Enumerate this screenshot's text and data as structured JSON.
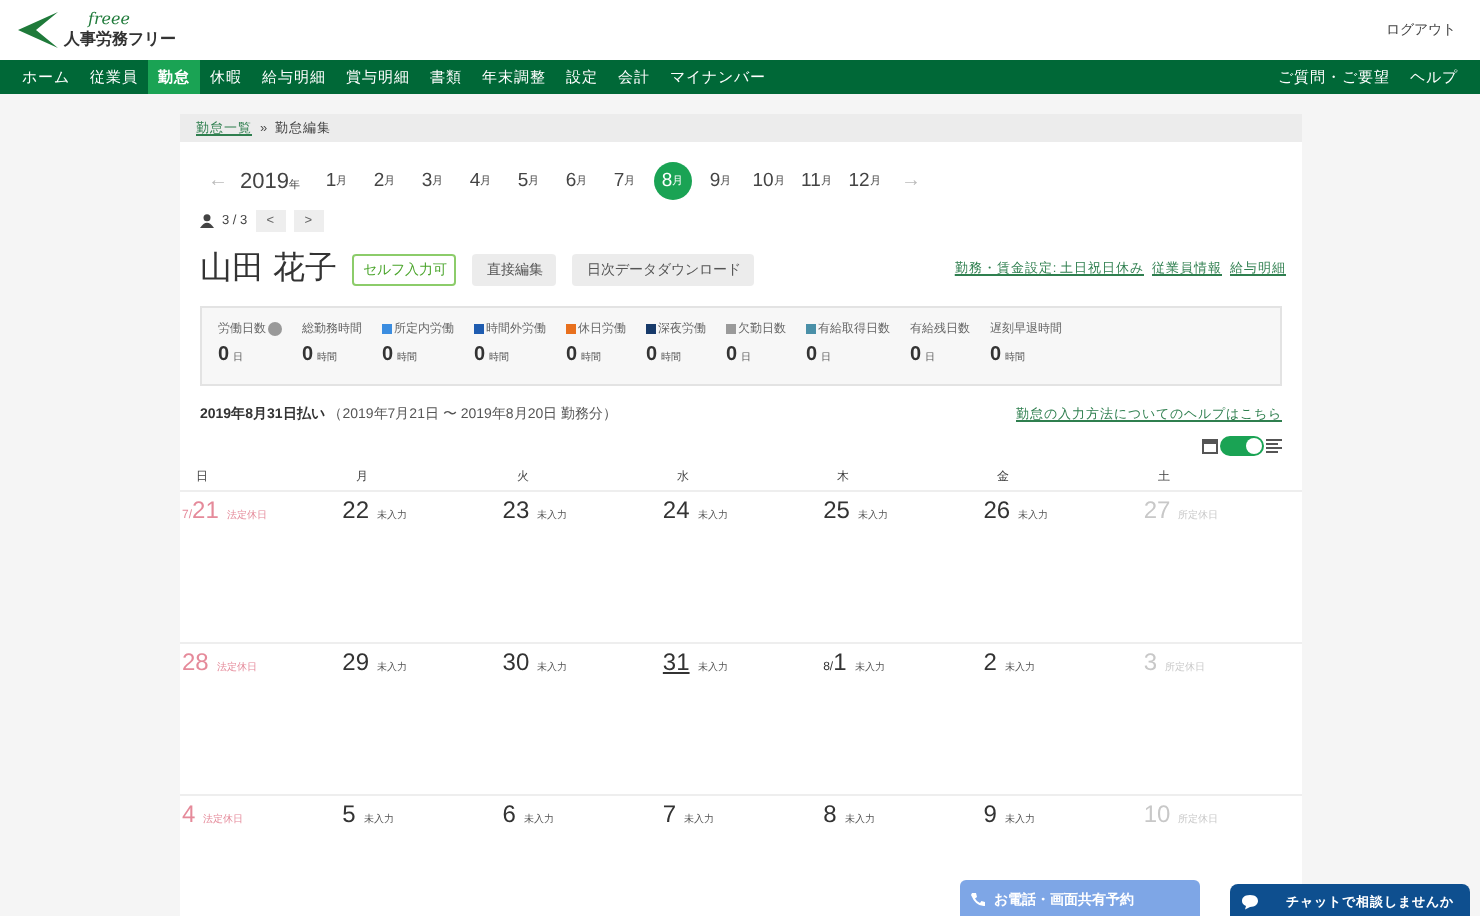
{
  "header": {
    "logo_script": "freee",
    "logo_text": "人事労務フリー",
    "logout": "ログアウト"
  },
  "nav": {
    "items": [
      {
        "label": "ホーム",
        "selected": false
      },
      {
        "label": "従業員",
        "selected": false
      },
      {
        "label": "勤怠",
        "selected": true
      },
      {
        "label": "休暇",
        "selected": false
      },
      {
        "label": "給与明細",
        "selected": false
      },
      {
        "label": "賞与明細",
        "selected": false
      },
      {
        "label": "書類",
        "selected": false
      },
      {
        "label": "年末調整",
        "selected": false
      },
      {
        "label": "設定",
        "selected": false
      },
      {
        "label": "会計",
        "selected": false
      },
      {
        "label": "マイナンバー",
        "selected": false
      }
    ],
    "right": [
      "ご質問・ご要望",
      "ヘルプ"
    ]
  },
  "breadcrumb": {
    "link": "勤怠一覧",
    "separator": "»",
    "current": "勤怠編集"
  },
  "months": {
    "prev": "←",
    "year": "2019",
    "year_unit": "年",
    "next": "→",
    "items": [
      {
        "label": "1",
        "unit": "月",
        "selected": false
      },
      {
        "label": "2",
        "unit": "月",
        "selected": false
      },
      {
        "label": "3",
        "unit": "月",
        "selected": false
      },
      {
        "label": "4",
        "unit": "月",
        "selected": false
      },
      {
        "label": "5",
        "unit": "月",
        "selected": false
      },
      {
        "label": "6",
        "unit": "月",
        "selected": false
      },
      {
        "label": "7",
        "unit": "月",
        "selected": false
      },
      {
        "label": "8",
        "unit": "月",
        "selected": true
      },
      {
        "label": "9",
        "unit": "月",
        "selected": false
      },
      {
        "label": "10",
        "unit": "月",
        "selected": false
      },
      {
        "label": "11",
        "unit": "月",
        "selected": false
      },
      {
        "label": "12",
        "unit": "月",
        "selected": false
      }
    ]
  },
  "pager": {
    "count": "3 / 3",
    "prev": "<",
    "next": ">"
  },
  "employee": {
    "name": "山田 花子",
    "badge": "セルフ入力可",
    "buttons": [
      "直接編集",
      "日次データダウンロード"
    ],
    "links": [
      "勤務・賃金設定: 土日祝日休み",
      "従業員情報",
      "給与明細"
    ]
  },
  "stats": [
    {
      "label": "労働日数",
      "help": true,
      "value": "0",
      "unit": "日"
    },
    {
      "label": "総勤務時間",
      "value": "0",
      "unit": "時間"
    },
    {
      "label": "所定内労働",
      "color": "#3b8de0",
      "value": "0",
      "unit": "時間"
    },
    {
      "label": "時間外労働",
      "color": "#1f5cb0",
      "value": "0",
      "unit": "時間"
    },
    {
      "label": "休日労働",
      "color": "#e8701e",
      "value": "0",
      "unit": "時間"
    },
    {
      "label": "深夜労働",
      "color": "#173a6a",
      "value": "0",
      "unit": "時間"
    },
    {
      "label": "欠勤日数",
      "color": "#9a9a9a",
      "value": "0",
      "unit": "日"
    },
    {
      "label": "有給取得日数",
      "color": "#4a90a8",
      "value": "0",
      "unit": "日"
    },
    {
      "label": "有給残日数",
      "value": "0",
      "unit": "日"
    },
    {
      "label": "遅刻早退時間",
      "value": "0",
      "unit": "時間"
    }
  ],
  "period": {
    "pay_date": "2019年8月31日払い",
    "range": "（2019年7月21日 〜 2019年8月20日 勤務分）",
    "help_link": "勤怠の入力方法についてのヘルプはこちら"
  },
  "view_toggle": {
    "on": true
  },
  "calendar": {
    "weekdays": [
      "日",
      "月",
      "火",
      "水",
      "木",
      "金",
      "土"
    ],
    "weeks": [
      [
        {
          "prefix": "7/",
          "day": "21",
          "status": "法定休日",
          "kind": "legal"
        },
        {
          "day": "22",
          "status": "未入力",
          "kind": "work"
        },
        {
          "day": "23",
          "status": "未入力",
          "kind": "work"
        },
        {
          "day": "24",
          "status": "未入力",
          "kind": "work"
        },
        {
          "day": "25",
          "status": "未入力",
          "kind": "work"
        },
        {
          "day": "26",
          "status": "未入力",
          "kind": "work"
        },
        {
          "day": "27",
          "status": "所定休日",
          "kind": "rest"
        }
      ],
      [
        {
          "day": "28",
          "status": "法定休日",
          "kind": "legal"
        },
        {
          "day": "29",
          "status": "未入力",
          "kind": "work"
        },
        {
          "day": "30",
          "status": "未入力",
          "kind": "work"
        },
        {
          "day": "31",
          "status": "未入力",
          "kind": "work",
          "today": true
        },
        {
          "prefix": "8/",
          "day": "1",
          "status": "未入力",
          "kind": "work"
        },
        {
          "day": "2",
          "status": "未入力",
          "kind": "work"
        },
        {
          "day": "3",
          "status": "所定休日",
          "kind": "rest"
        }
      ],
      [
        {
          "day": "4",
          "status": "法定休日",
          "kind": "legal"
        },
        {
          "day": "5",
          "status": "未入力",
          "kind": "work"
        },
        {
          "day": "6",
          "status": "未入力",
          "kind": "work"
        },
        {
          "day": "7",
          "status": "未入力",
          "kind": "work"
        },
        {
          "day": "8",
          "status": "未入力",
          "kind": "work"
        },
        {
          "day": "9",
          "status": "未入力",
          "kind": "work"
        },
        {
          "day": "10",
          "status": "所定休日",
          "kind": "rest"
        }
      ]
    ]
  },
  "floating": {
    "phone": "お電話・画面共有予約",
    "chat": "チャットで相談しませんか"
  }
}
